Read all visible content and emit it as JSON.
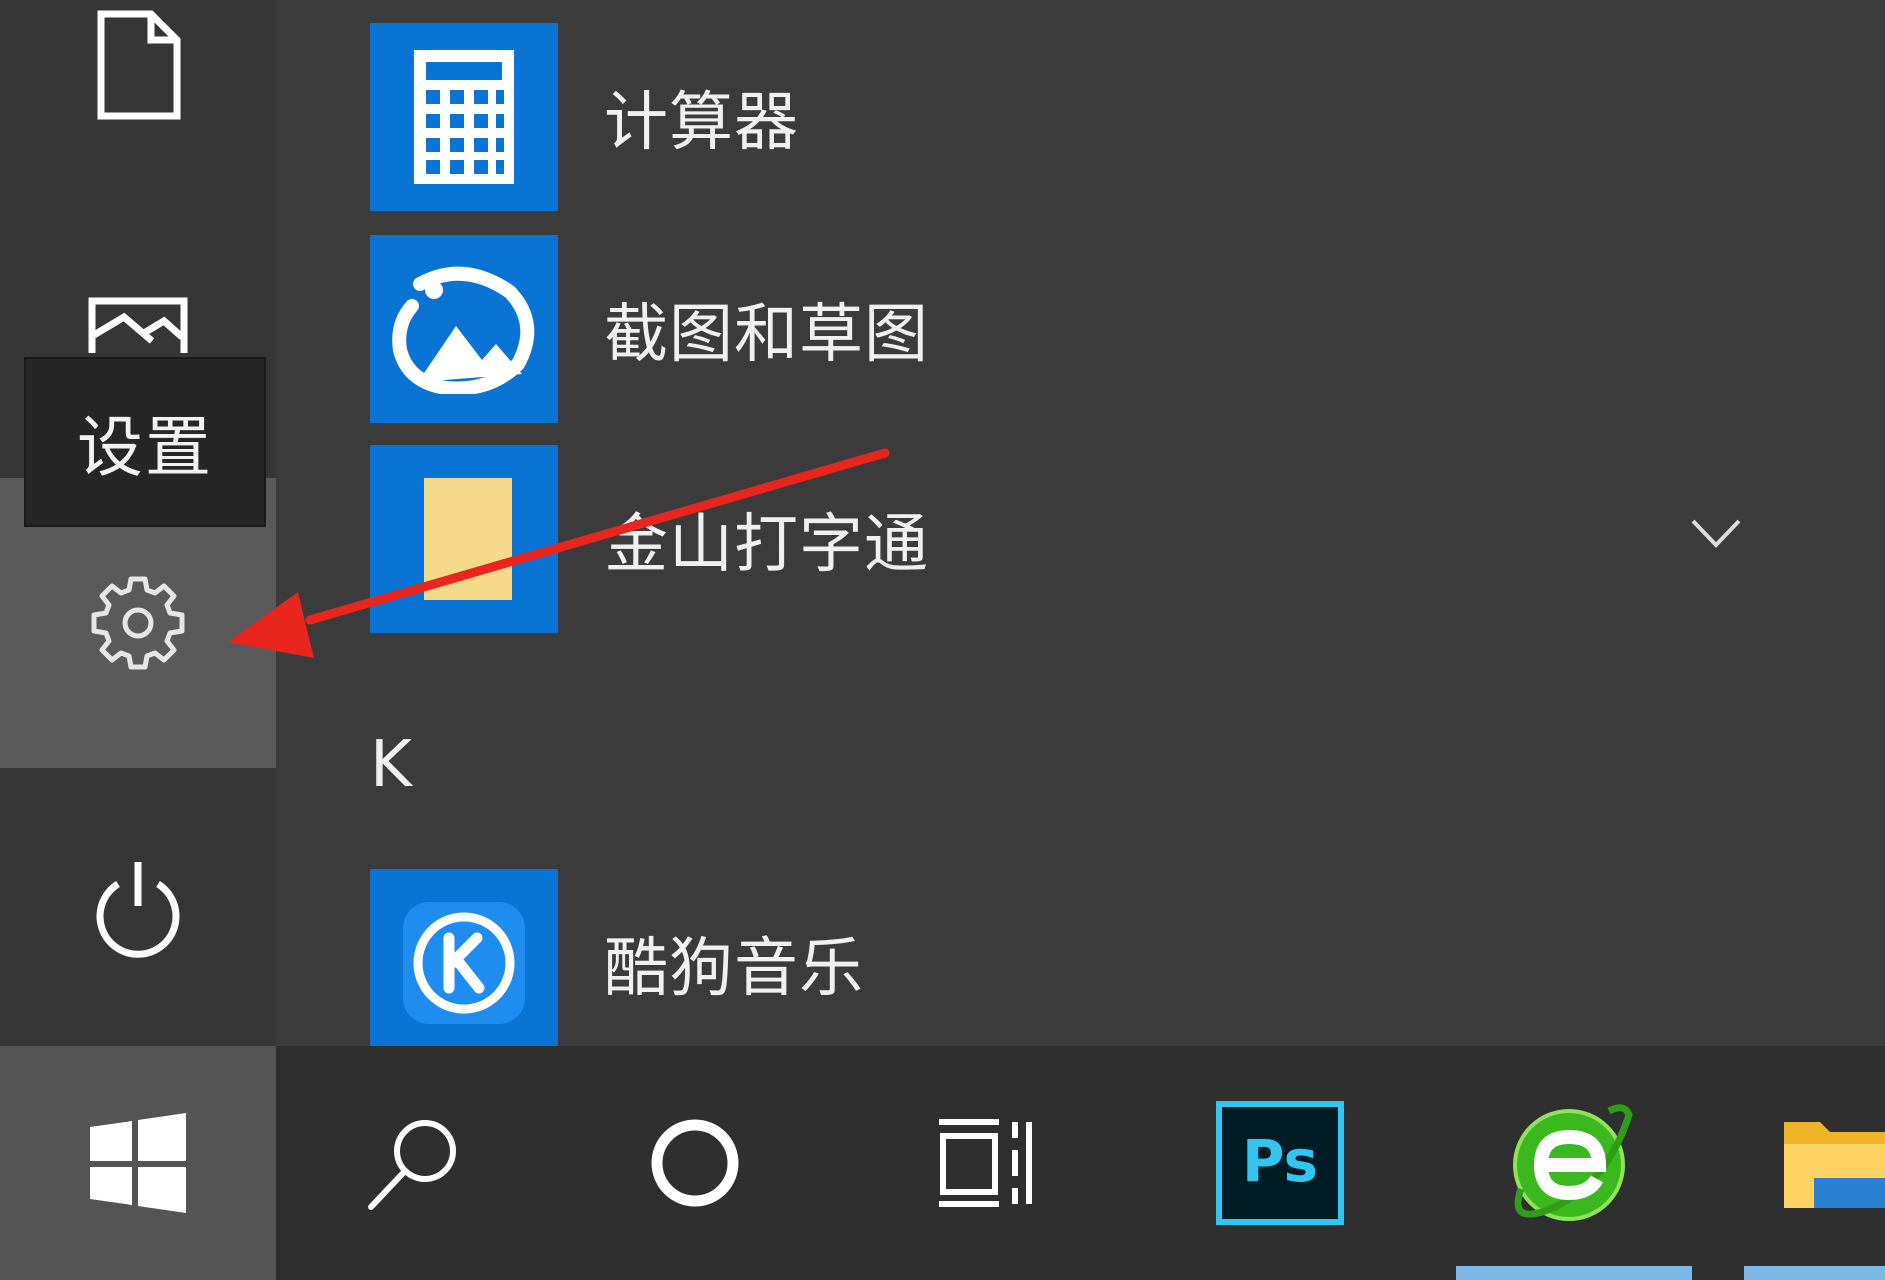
{
  "tooltip": {
    "text": "设置"
  },
  "apps": [
    {
      "label": "计算器",
      "icon": "calculator-icon",
      "tile_color": "#0a74d4"
    },
    {
      "label": "截图和草图",
      "icon": "snip-sketch-icon",
      "tile_color": "#0a74d4"
    },
    {
      "label": "金山打字通",
      "icon": "kingsoft-typing-icon",
      "tile_color": "#0a74d4"
    },
    {
      "label": "酷狗音乐",
      "icon": "kugou-music-icon",
      "tile_color": "#0a74d4"
    }
  ],
  "section_letter": "K",
  "left_rail": [
    "document-icon",
    "pictures-icon",
    "gear-icon",
    "power-icon"
  ],
  "taskbar": [
    "windows-start-icon",
    "search-icon",
    "cortana-icon",
    "task-view-icon",
    "photoshop-icon",
    "browser-icon",
    "file-explorer-icon"
  ],
  "taskbar_ps_label": "Ps",
  "colors": {
    "accent": "#0a74d4",
    "arrow": "#e8261e",
    "active_indicator": "#7ab8e8"
  }
}
